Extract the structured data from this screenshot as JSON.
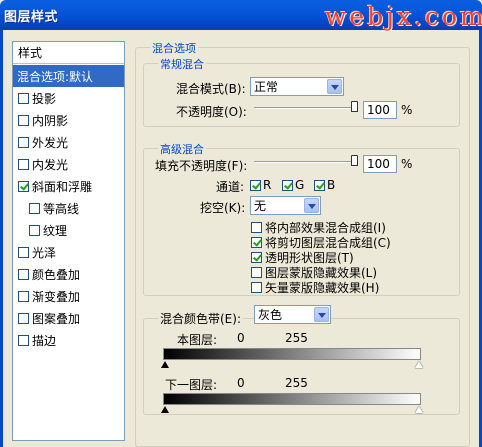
{
  "window": {
    "title": "图层样式",
    "watermark": "webjx.com"
  },
  "styles_list": {
    "header": "样式",
    "selected": "混合选项:默认",
    "items": [
      {
        "label": "投影",
        "checked": false,
        "indent": false
      },
      {
        "label": "内阴影",
        "checked": false,
        "indent": false
      },
      {
        "label": "外发光",
        "checked": false,
        "indent": false
      },
      {
        "label": "内发光",
        "checked": false,
        "indent": false
      },
      {
        "label": "斜面和浮雕",
        "checked": true,
        "indent": false
      },
      {
        "label": "等高线",
        "checked": false,
        "indent": true
      },
      {
        "label": "纹理",
        "checked": false,
        "indent": true
      },
      {
        "label": "光泽",
        "checked": false,
        "indent": false
      },
      {
        "label": "颜色叠加",
        "checked": false,
        "indent": false
      },
      {
        "label": "渐变叠加",
        "checked": false,
        "indent": false
      },
      {
        "label": "图案叠加",
        "checked": false,
        "indent": false
      },
      {
        "label": "描边",
        "checked": false,
        "indent": false
      }
    ]
  },
  "blending": {
    "section_title": "混合选项",
    "general": {
      "title": "常规混合",
      "mode_label": "混合模式(B):",
      "mode_value": "正常",
      "opacity_label": "不透明度(O):",
      "opacity_value": "100",
      "opacity_unit": "%",
      "opacity_fraction": 1.0
    },
    "advanced": {
      "title": "高级混合",
      "fill_label": "填充不透明度(F):",
      "fill_value": "100",
      "fill_unit": "%",
      "fill_fraction": 1.0,
      "channels_label": "通道:",
      "channels": [
        {
          "label": "R",
          "checked": true
        },
        {
          "label": "G",
          "checked": true
        },
        {
          "label": "B",
          "checked": true
        }
      ],
      "knockout_label": "挖空(K):",
      "knockout_value": "无",
      "options": [
        {
          "label": "将内部效果混合成组(I)",
          "checked": false
        },
        {
          "label": "将剪切图层混合成组(C)",
          "checked": true
        },
        {
          "label": "透明形状图层(T)",
          "checked": true
        },
        {
          "label": "图层蒙版隐藏效果(L)",
          "checked": false
        },
        {
          "label": "矢量蒙版隐藏效果(H)",
          "checked": false
        }
      ]
    },
    "blend_if": {
      "label": "混合颜色带(E):",
      "value": "灰色",
      "this_layer_label": "本图层:",
      "this_layer_min": "0",
      "this_layer_max": "255",
      "underlying_label": "下一图层:",
      "underlying_min": "0",
      "underlying_max": "255"
    }
  }
}
